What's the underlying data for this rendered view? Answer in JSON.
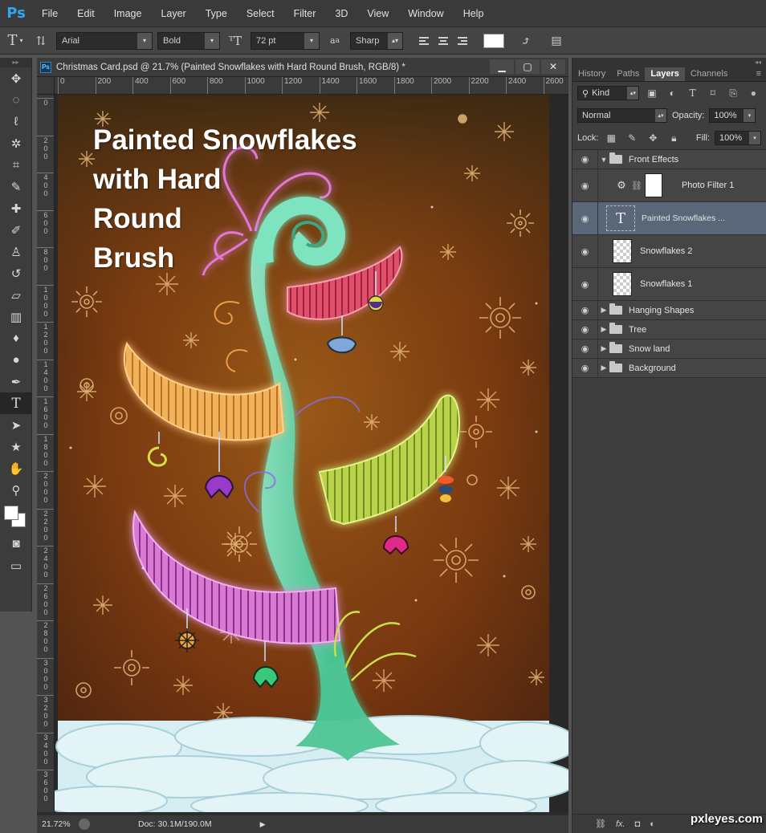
{
  "menubar": {
    "logo": "Ps",
    "items": [
      "File",
      "Edit",
      "Image",
      "Layer",
      "Type",
      "Select",
      "Filter",
      "3D",
      "View",
      "Window",
      "Help"
    ]
  },
  "options": {
    "tool_glyph": "T",
    "font_family": "Arial",
    "font_style": "Bold",
    "font_size": "72 pt",
    "aa_label": "a",
    "antialias": "Sharp",
    "text_color": "#ffffff"
  },
  "document": {
    "title": "Christmas Card.psd @ 21.7% (Painted Snowflakes with Hard Round Brush, RGB/8) *",
    "ruler_top": [
      "0",
      "200",
      "400",
      "600",
      "800",
      "1000",
      "1200",
      "1400",
      "1600",
      "1800",
      "2000",
      "2200",
      "2400",
      "2600"
    ],
    "ruler_left": [
      "0",
      "2 0 0",
      "4 0 0",
      "6 0 0",
      "8 0 0",
      "1 0 0 0",
      "1 2 0 0",
      "1 4 0 0",
      "1 6 0 0",
      "1 8 0 0",
      "2 0 0 0",
      "2 2 0 0",
      "2 4 0 0",
      "2 6 0 0",
      "2 8 0 0",
      "3 0 0 0",
      "3 2 0 0",
      "3 4 0 0",
      "3 6 0 0"
    ],
    "canvas_text": [
      "Painted Snowflakes",
      "with Hard",
      "Round",
      "Brush"
    ],
    "zoom": "21.72%",
    "doc_size": "Doc: 30.1M/190.0M"
  },
  "panel": {
    "tabs": [
      "History",
      "Paths",
      "Layers",
      "Channels"
    ],
    "active_tab": "Layers",
    "filter_kind": "Kind",
    "blend_mode": "Normal",
    "opacity_label": "Opacity:",
    "opacity": "100%",
    "lock_label": "Lock:",
    "fill_label": "Fill:",
    "fill": "100%",
    "layers": [
      {
        "name": "Front Effects",
        "type": "group-open"
      },
      {
        "name": "Photo Filter 1",
        "type": "adjustment"
      },
      {
        "name": "Painted Snowflakes ...",
        "type": "text",
        "selected": true
      },
      {
        "name": "Snowflakes 2",
        "type": "pixel"
      },
      {
        "name": "Snowflakes 1",
        "type": "pixel"
      },
      {
        "name": "Hanging Shapes",
        "type": "group"
      },
      {
        "name": "Tree",
        "type": "group"
      },
      {
        "name": "Snow land",
        "type": "group"
      },
      {
        "name": "Background",
        "type": "group"
      }
    ],
    "footer_fx": "fx."
  },
  "watermark": "pxleyes.com",
  "colors": {
    "canvas_bg_top": "#3b2410",
    "canvas_bg_mid": "#8a4a14",
    "canvas_bg_bottom": "#6b2e10",
    "tree": "#5fd1a4",
    "selected_layer": "#5a6778"
  }
}
